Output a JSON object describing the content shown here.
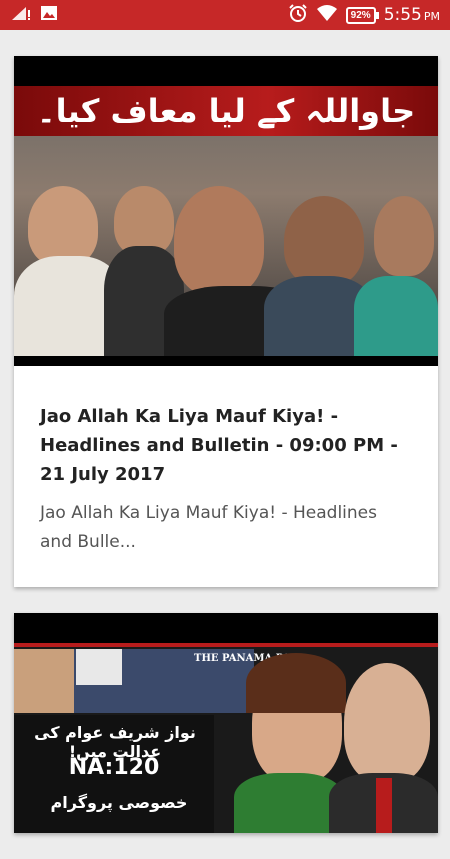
{
  "status_bar": {
    "time": "5:55",
    "ampm": "PM",
    "battery": "92%",
    "icons": [
      "signal-icon",
      "image-icon",
      "alarm-icon",
      "wifi-icon",
      "battery-icon"
    ]
  },
  "feed": {
    "items": [
      {
        "thumbnail_caption": "جاواللہ کے لیا معاف کیا۔",
        "title": "Jao Allah Ka Liya Mauf Kiya! - Headlines and Bulletin - 09:00 PM - 21 July 2017",
        "description": "Jao Allah Ka Liya Mauf Kiya! - Headlines and Bulle..."
      },
      {
        "thumbnail_top_label": "THE PANAMA PA",
        "thumbnail_caption_1": "نواز شریف عوام کی عدالت میں!",
        "thumbnail_caption_2": "NA:120",
        "thumbnail_caption_3": "خصوصی پروگرام"
      }
    ]
  }
}
